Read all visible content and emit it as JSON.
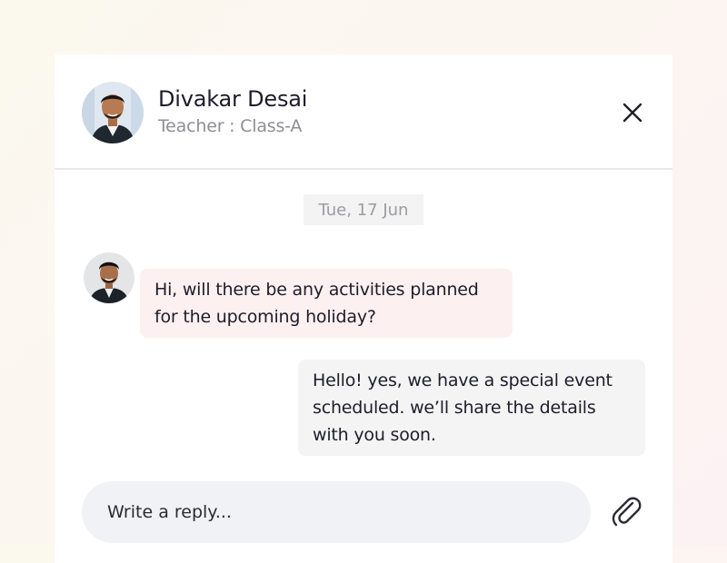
{
  "header": {
    "name": "Divakar Desai",
    "role": "Teacher : Class-A"
  },
  "conversation": {
    "date": "Tue, 17 Jun",
    "messages": [
      {
        "direction": "incoming",
        "lines": [
          "Hi, will there be any activities planned",
          "for the upcoming holiday?"
        ]
      },
      {
        "direction": "outgoing",
        "lines": [
          "Hello! yes, we have a special event",
          "scheduled. we’ll share the details",
          "with you soon."
        ]
      }
    ]
  },
  "composer": {
    "placeholder": "Write a reply..."
  },
  "icons": {
    "close": "close-icon",
    "attach": "paperclip-icon"
  },
  "colors": {
    "incoming_bubble": "#fdf0f0",
    "outgoing_bubble": "#f4f4f4",
    "input_background": "#f1f2f5"
  }
}
